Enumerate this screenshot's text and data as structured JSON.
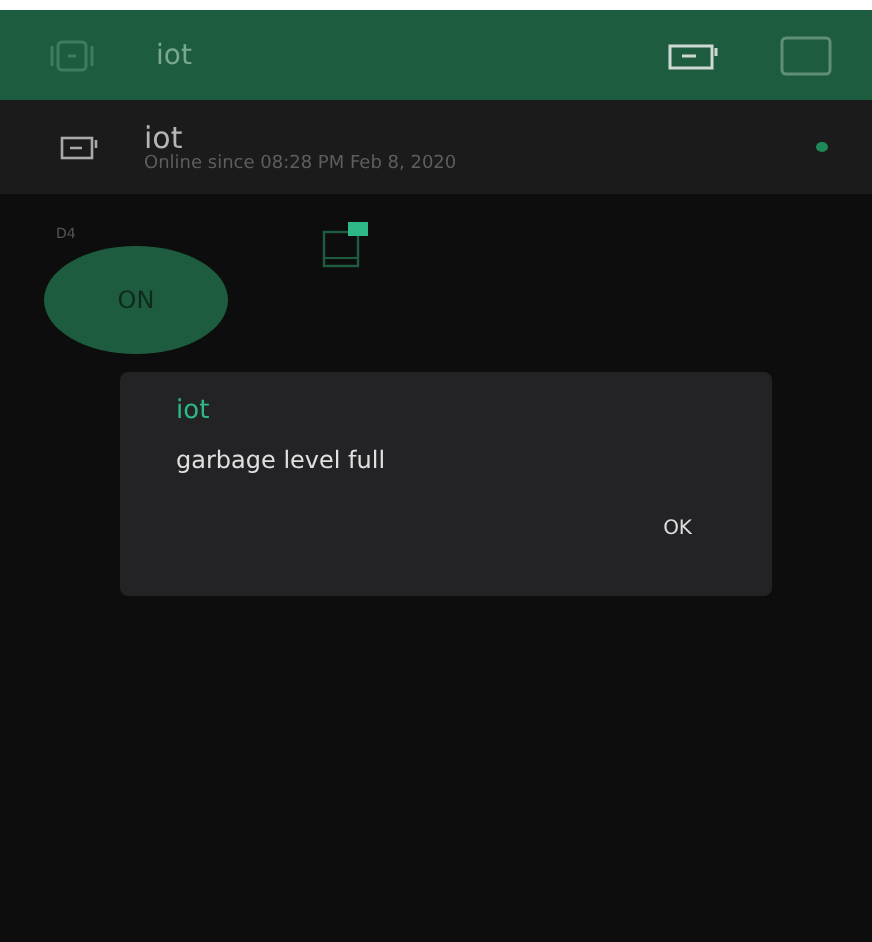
{
  "header": {
    "title": "iot"
  },
  "device": {
    "name": "iot",
    "status": "Online since 08:28 PM Feb 8, 2020",
    "online": true
  },
  "widgets": {
    "pin": "D4",
    "button": {
      "label": "ON",
      "on": true
    }
  },
  "dialog": {
    "title": "iot",
    "message": "garbage level full",
    "button": "OK"
  }
}
